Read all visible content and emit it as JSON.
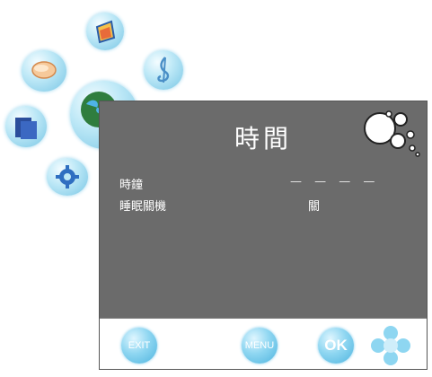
{
  "osd": {
    "title": "時間",
    "items": [
      {
        "label": "時鐘",
        "value": "— — — —"
      },
      {
        "label": "睡眠關機",
        "value": "關"
      }
    ],
    "footer": {
      "exit_label": "EXIT",
      "menu_label": "MENU",
      "ok_label": "OK"
    }
  },
  "side_icons": [
    "picture-icon",
    "music-icon",
    "chat-icon",
    "time-icon",
    "files-icon",
    "setup-icon"
  ],
  "colors": {
    "panel": "#6b6b6b",
    "accent": "#79c6e5",
    "text": "#ffffff"
  }
}
